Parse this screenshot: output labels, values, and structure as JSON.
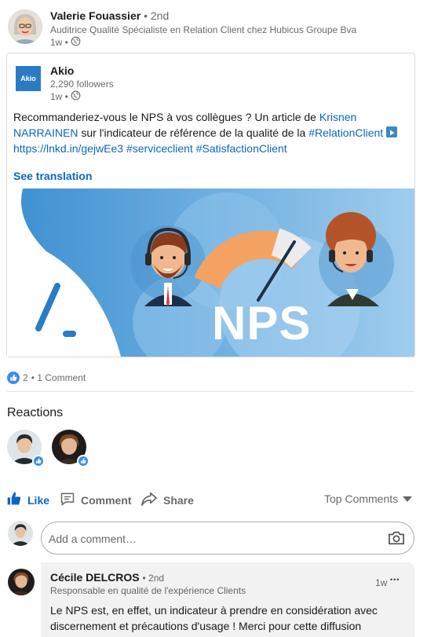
{
  "author": {
    "name": "Valerie Fouassier",
    "degree": "• 2nd",
    "headline": "Auditrice Qualité Spécialiste en Relation Client chez Hubicus Groupe Bva",
    "time": "1w •"
  },
  "shared_post": {
    "company": "Akio",
    "logo_text": "Akio",
    "followers": "2,290 followers",
    "time": "1w •",
    "text_before": "Recommanderiez-vous le NPS à vos collègues ? Un article de ",
    "mention": "Krisnen NARRAINEN",
    "text_middle": " sur l'indicateur de référence de la qualité de la ",
    "hashtag_1": "#RelationClient",
    "short_link": "https://lnkd.in/gejwEe3",
    "hashtag_2": "#serviceclient",
    "hashtag_3": "#SatisfactionClient",
    "see_translation": "See translation",
    "banner_text": "NPS"
  },
  "social": {
    "reaction_count": "2",
    "comment_count": "• 1 Comment"
  },
  "reactions": {
    "heading": "Reactions"
  },
  "actions": {
    "like": "Like",
    "comment": "Comment",
    "share": "Share",
    "sort": "Top Comments"
  },
  "comment_box": {
    "placeholder": "Add a comment…"
  },
  "comment": {
    "name": "Cécile DELCROS",
    "degree": "• 2nd",
    "headline": "Responsable en qualité de l'expérience Clients",
    "time": "1w",
    "more": "•••",
    "text": "Le NPS est, en effet, un indicateur à prendre en considération avec discernement et précautions d'usage ! Merci pour cette diffusion"
  },
  "colors": {
    "brand_blue": "#0a66c2",
    "banner_blue": "#4ea3dc",
    "gauge_orange": "#f4a261"
  }
}
